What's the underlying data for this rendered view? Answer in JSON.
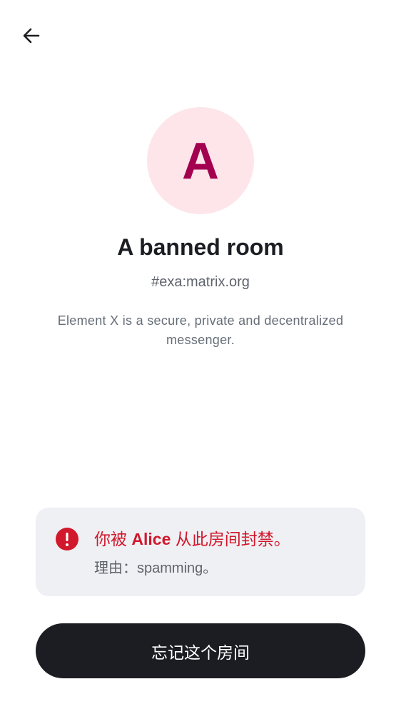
{
  "header": {
    "back_icon": "arrow-left-icon"
  },
  "room": {
    "avatar_letter": "A",
    "avatar_bg": "#fde5ea",
    "avatar_fg": "#a3004f",
    "name": "A banned room",
    "alias": "#exa:matrix.org",
    "topic": "Element X is a secure, private and decentralized messenger."
  },
  "ban_notice": {
    "icon": "error-icon",
    "message_prefix": "你被 ",
    "banned_by": "Alice",
    "message_suffix": " 从此房间封禁。",
    "reason": "理由：spamming。",
    "accent": "#d1182c"
  },
  "actions": {
    "forget_label": "忘记这个房间"
  }
}
